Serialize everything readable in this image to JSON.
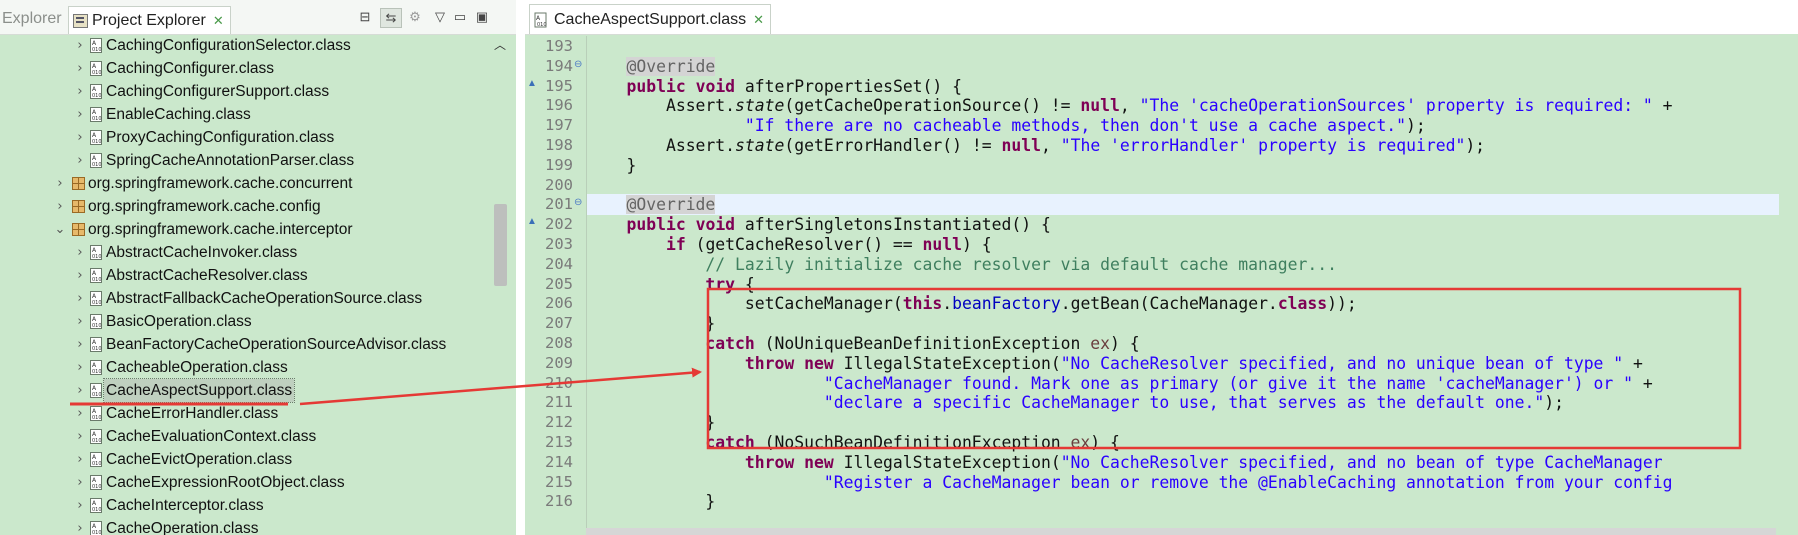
{
  "left_tabs": {
    "inactive": "Explorer",
    "active": "Project Explorer",
    "close": "✕"
  },
  "left_tools": [
    "⊟",
    "⇆",
    "⚙",
    "▽",
    "▭"
  ],
  "tree": [
    {
      "label": "CachingConfigurationSelector.class",
      "kind": "class",
      "level": 2
    },
    {
      "label": "CachingConfigurer.class",
      "kind": "class",
      "level": 2
    },
    {
      "label": "CachingConfigurerSupport.class",
      "kind": "class",
      "level": 2
    },
    {
      "label": "EnableCaching.class",
      "kind": "class",
      "level": 2
    },
    {
      "label": "ProxyCachingConfiguration.class",
      "kind": "class",
      "level": 2
    },
    {
      "label": "SpringCacheAnnotationParser.class",
      "kind": "class",
      "level": 2
    },
    {
      "label": "org.springframework.cache.concurrent",
      "kind": "package",
      "level": 1,
      "expanded": false
    },
    {
      "label": "org.springframework.cache.config",
      "kind": "package",
      "level": 1,
      "expanded": false
    },
    {
      "label": "org.springframework.cache.interceptor",
      "kind": "package",
      "level": 1,
      "expanded": true
    },
    {
      "label": "AbstractCacheInvoker.class",
      "kind": "class",
      "level": 2
    },
    {
      "label": "AbstractCacheResolver.class",
      "kind": "class",
      "level": 2
    },
    {
      "label": "AbstractFallbackCacheOperationSource.class",
      "kind": "class",
      "level": 2
    },
    {
      "label": "BasicOperation.class",
      "kind": "class",
      "level": 2
    },
    {
      "label": "BeanFactoryCacheOperationSourceAdvisor.class",
      "kind": "class",
      "level": 2
    },
    {
      "label": "CacheableOperation.class",
      "kind": "class",
      "level": 2
    },
    {
      "label": "CacheAspectSupport.class",
      "kind": "class",
      "level": 2,
      "selected": true
    },
    {
      "label": "CacheErrorHandler.class",
      "kind": "class",
      "level": 2
    },
    {
      "label": "CacheEvaluationContext.class",
      "kind": "class",
      "level": 2
    },
    {
      "label": "CacheEvictOperation.class",
      "kind": "class",
      "level": 2
    },
    {
      "label": "CacheExpressionRootObject.class",
      "kind": "class",
      "level": 2
    },
    {
      "label": "CacheInterceptor.class",
      "kind": "class",
      "level": 2
    },
    {
      "label": "CacheOperation.class",
      "kind": "class",
      "level": 2
    }
  ],
  "editor": {
    "tab_label": "CacheAspectSupport.class",
    "tab_close": "✕",
    "lines": [
      {
        "n": "193",
        "fold": "",
        "code": [
          [
            "",
            ""
          ]
        ]
      },
      {
        "n": "194",
        "fold": "⊖",
        "code": [
          [
            "",
            "\t"
          ],
          [
            "an",
            "@Override"
          ]
        ]
      },
      {
        "n": "195",
        "fold": "",
        "code": [
          [
            "",
            "\t"
          ],
          [
            "kw",
            "public"
          ],
          [
            "",
            " "
          ],
          [
            "kw",
            "void"
          ],
          [
            "",
            " afterPropertiesSet() {"
          ]
        ]
      },
      {
        "n": "196",
        "fold": "",
        "code": [
          [
            "",
            "\t\t"
          ],
          [
            "",
            "Assert."
          ],
          [
            "it",
            "state"
          ],
          [
            "",
            "(getCacheOperationSource() != "
          ],
          [
            "kw",
            "null"
          ],
          [
            "",
            ", "
          ],
          [
            "str",
            "\"The 'cacheOperationSources' property is required: \""
          ],
          [
            "",
            " +"
          ]
        ]
      },
      {
        "n": "197",
        "fold": "",
        "code": [
          [
            "",
            "\t\t\t\t"
          ],
          [
            "str",
            "\"If there are no cacheable methods, then don't use a cache aspect.\""
          ],
          [
            "",
            ");"
          ]
        ]
      },
      {
        "n": "198",
        "fold": "",
        "code": [
          [
            "",
            "\t\t"
          ],
          [
            "",
            "Assert."
          ],
          [
            "it",
            "state"
          ],
          [
            "",
            "(getErrorHandler() != "
          ],
          [
            "kw",
            "null"
          ],
          [
            "",
            ", "
          ],
          [
            "str",
            "\"The 'errorHandler' property is required\""
          ],
          [
            "",
            ");"
          ]
        ]
      },
      {
        "n": "199",
        "fold": "",
        "code": [
          [
            "",
            "\t}"
          ]
        ]
      },
      {
        "n": "200",
        "fold": "",
        "code": [
          [
            "",
            ""
          ]
        ]
      },
      {
        "n": "201",
        "fold": "⊖",
        "code": [
          [
            "",
            "\t"
          ],
          [
            "an",
            "@Override"
          ]
        ],
        "highlight": true
      },
      {
        "n": "202",
        "fold": "",
        "code": [
          [
            "",
            "\t"
          ],
          [
            "kw",
            "public"
          ],
          [
            "",
            " "
          ],
          [
            "kw",
            "void"
          ],
          [
            "",
            " afterSingletonsInstantiated() {"
          ]
        ]
      },
      {
        "n": "203",
        "fold": "",
        "code": [
          [
            "",
            "\t\t"
          ],
          [
            "kw",
            "if"
          ],
          [
            "",
            " (getCacheResolver() == "
          ],
          [
            "kw",
            "null"
          ],
          [
            "",
            ") {"
          ]
        ]
      },
      {
        "n": "204",
        "fold": "",
        "code": [
          [
            "",
            "\t\t\t"
          ],
          [
            "cm",
            "// Lazily initialize cache resolver via default cache manager..."
          ]
        ]
      },
      {
        "n": "205",
        "fold": "",
        "code": [
          [
            "",
            "\t\t\t"
          ],
          [
            "kw",
            "try"
          ],
          [
            "",
            " {"
          ]
        ]
      },
      {
        "n": "206",
        "fold": "",
        "code": [
          [
            "",
            "\t\t\t\t"
          ],
          [
            "",
            "setCacheManager("
          ],
          [
            "kw",
            "this"
          ],
          [
            "",
            "."
          ],
          [
            "fld",
            "beanFactory"
          ],
          [
            "",
            ".getBean(CacheManager."
          ],
          [
            "kw",
            "class"
          ],
          [
            "",
            "));"
          ]
        ]
      },
      {
        "n": "207",
        "fold": "",
        "code": [
          [
            "",
            "\t\t\t}"
          ]
        ]
      },
      {
        "n": "208",
        "fold": "",
        "code": [
          [
            "",
            "\t\t\t"
          ],
          [
            "kw",
            "catch"
          ],
          [
            "",
            " (NoUniqueBeanDefinitionException "
          ],
          [
            "var",
            "ex"
          ],
          [
            "",
            ") {"
          ]
        ]
      },
      {
        "n": "209",
        "fold": "",
        "code": [
          [
            "",
            "\t\t\t\t"
          ],
          [
            "kw",
            "throw"
          ],
          [
            "",
            " "
          ],
          [
            "kw",
            "new"
          ],
          [
            "",
            " IllegalStateException("
          ],
          [
            "str",
            "\"No CacheResolver specified, and no unique bean of type \""
          ],
          [
            "",
            " +"
          ]
        ]
      },
      {
        "n": "210",
        "fold": "",
        "code": [
          [
            "",
            "\t\t\t\t\t\t"
          ],
          [
            "str",
            "\"CacheManager found. Mark one as primary (or give it the name 'cacheManager') or \""
          ],
          [
            "",
            " +"
          ]
        ]
      },
      {
        "n": "211",
        "fold": "",
        "code": [
          [
            "",
            "\t\t\t\t\t\t"
          ],
          [
            "str",
            "\"declare a specific CacheManager to use, that serves as the default one.\""
          ],
          [
            "",
            ");"
          ]
        ]
      },
      {
        "n": "212",
        "fold": "",
        "code": [
          [
            "",
            "\t\t\t}"
          ]
        ]
      },
      {
        "n": "213",
        "fold": "",
        "code": [
          [
            "",
            "\t\t\t"
          ],
          [
            "kw",
            "catch"
          ],
          [
            "",
            " (NoSuchBeanDefinitionException "
          ],
          [
            "var",
            "ex"
          ],
          [
            "",
            ") {"
          ]
        ]
      },
      {
        "n": "214",
        "fold": "",
        "code": [
          [
            "",
            "\t\t\t\t"
          ],
          [
            "kw",
            "throw"
          ],
          [
            "",
            " "
          ],
          [
            "kw",
            "new"
          ],
          [
            "",
            " IllegalStateException("
          ],
          [
            "str",
            "\"No CacheResolver specified, and no bean of type CacheManager"
          ]
        ]
      },
      {
        "n": "215",
        "fold": "",
        "code": [
          [
            "",
            "\t\t\t\t\t\t"
          ],
          [
            "str",
            "\"Register a CacheManager bean or remove the @EnableCaching annotation from your config"
          ]
        ]
      },
      {
        "n": "216",
        "fold": "",
        "code": [
          [
            "",
            "\t\t\t}"
          ]
        ]
      }
    ]
  },
  "annotation": {
    "color": "#e53935"
  },
  "colors": {
    "pane_bg": "#cbe8cc",
    "selected_bg": "#bfd0bf",
    "line_highlight": "#e8f2fe"
  }
}
